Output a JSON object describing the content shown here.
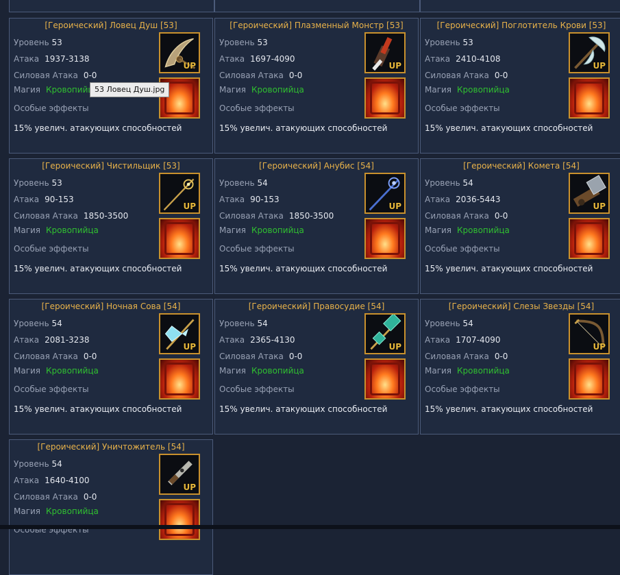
{
  "labels": {
    "level": "Уровень",
    "attack": "Атака",
    "power_attack": "Силовая Атака",
    "magic": "Магия",
    "special_effects": "Особые эффекты",
    "up_badge": "UP"
  },
  "tooltip": "53 Ловец Душ.jpg",
  "colors": {
    "title": "#e8b24a",
    "magic_value": "#30c030",
    "icon_border": "#c9912d",
    "card_border": "#4c5b7a",
    "background": "#1b2334"
  },
  "items": [
    {
      "title": "[Героический] Ловец Душ [53]",
      "level": "53",
      "attack": "1937-3138",
      "power_attack": "0-0",
      "magic": "Кровопийца",
      "effect": "15% увелич. атакующих способностей",
      "icon": "crescent-blade-icon"
    },
    {
      "title": "[Героический] Плазменный Монстр [53]",
      "level": "53",
      "attack": "1697-4090",
      "power_attack": "0-0",
      "magic": "Кровопийца",
      "effect": "15% увелич. атакующих способностей",
      "icon": "plasma-gun-icon"
    },
    {
      "title": "[Героический] Поглотитель Крови [53]",
      "level": "53",
      "attack": "2410-4108",
      "power_attack": "0-0",
      "magic": "Кровопийца",
      "effect": "15% увелич. атакующих способностей",
      "icon": "battle-axe-icon"
    },
    {
      "title": "[Героический] Чистильщик [53]",
      "level": "53",
      "attack": "90-153",
      "power_attack": "1850-3500",
      "magic": "Кровопийца",
      "effect": "15% увелич. атакующих способностей",
      "icon": "staff-icon"
    },
    {
      "title": "[Героический] Анубис [54]",
      "level": "54",
      "attack": "90-153",
      "power_attack": "1850-3500",
      "magic": "Кровопийца",
      "effect": "15% увелич. атакующих способностей",
      "icon": "blue-staff-icon"
    },
    {
      "title": "[Героический] Комета [54]",
      "level": "54",
      "attack": "2036-5443",
      "power_attack": "0-0",
      "magic": "Кровопийца",
      "effect": "15% увелич. атакующих способностей",
      "icon": "heavy-cannon-icon"
    },
    {
      "title": "[Героический] Ночная Сова [54]",
      "level": "54",
      "attack": "2081-3238",
      "power_attack": "0-0",
      "magic": "Кровопийца",
      "effect": "15% увелич. атакующих способностей",
      "icon": "ice-axe-icon"
    },
    {
      "title": "[Героический] Правосудие [54]",
      "level": "54",
      "attack": "2365-4130",
      "power_attack": "0-0",
      "magic": "Кровопийца",
      "effect": "15% увелич. атакующих способностей",
      "icon": "jade-hammer-icon"
    },
    {
      "title": "[Героический] Слезы Звезды [54]",
      "level": "54",
      "attack": "1707-4090",
      "power_attack": "0-0",
      "magic": "Кровопийца",
      "effect": "15% увелич. атакующих способностей",
      "icon": "bow-icon"
    },
    {
      "title": "[Героический] Уничтожитель [54]",
      "level": "54",
      "attack": "1640-4100",
      "power_attack": "0-0",
      "magic": "Кровопийца",
      "effect": "",
      "icon": "rifle-icon"
    }
  ]
}
